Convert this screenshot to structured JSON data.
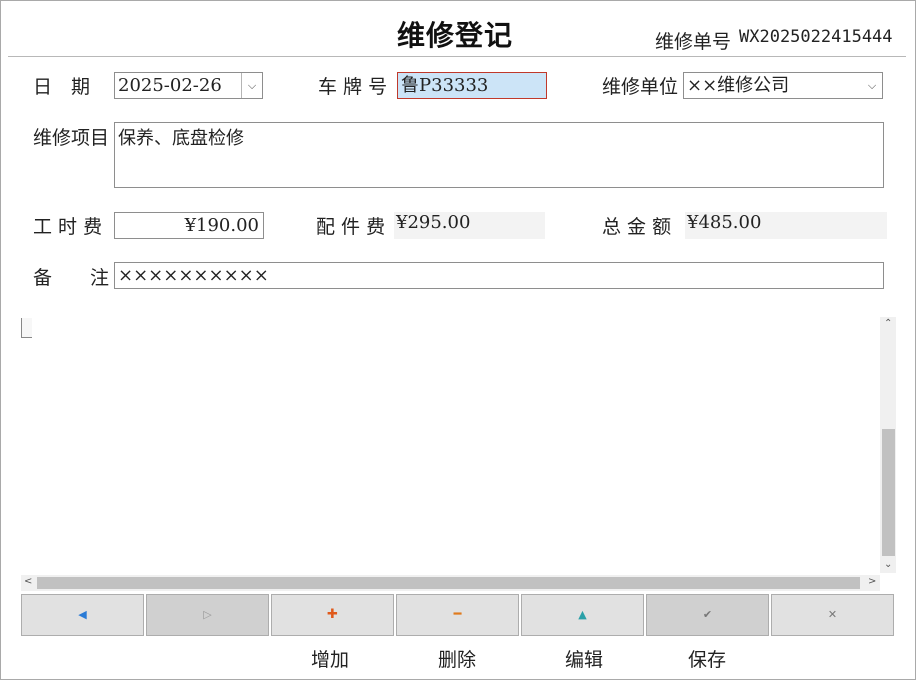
{
  "header": {
    "title": "维修登记",
    "order_label": "维修单号",
    "order_value": "WX2025022415444"
  },
  "form": {
    "date_label": "日　期",
    "date_value": "2025-02-26",
    "plate_label": "车 牌 号",
    "plate_value": "鲁P33333",
    "unit_label": "维修单位",
    "unit_value": "××维修公司",
    "items_label": "维修项目",
    "items_value": "保养、底盘检修",
    "labor_label": "工 时 费",
    "labor_value": "¥190.00",
    "parts_label": "配 件 费",
    "parts_value": "¥295.00",
    "total_label": "总 金 额",
    "total_value": "¥485.00",
    "remark_label": "备　　注",
    "remark_value": "××××××××××"
  },
  "icons": {
    "dropdown": "chevron-down-icon",
    "prev": "triangle-left-icon",
    "next": "triangle-right-icon",
    "add": "plus-icon",
    "delete": "minus-icon",
    "edit": "triangle-up-icon",
    "save": "check-icon",
    "cancel": "close-icon"
  },
  "toolbar": {
    "add_label": "增加",
    "delete_label": "删除",
    "edit_label": "编辑",
    "save_label": "保存"
  },
  "colors": {
    "prev": "#2a7bd6",
    "add": "#e05a1c",
    "delete": "#e07a1c",
    "edit": "#2aa0a8",
    "plate_border": "#c0392b",
    "plate_fill": "#cce4f7"
  }
}
